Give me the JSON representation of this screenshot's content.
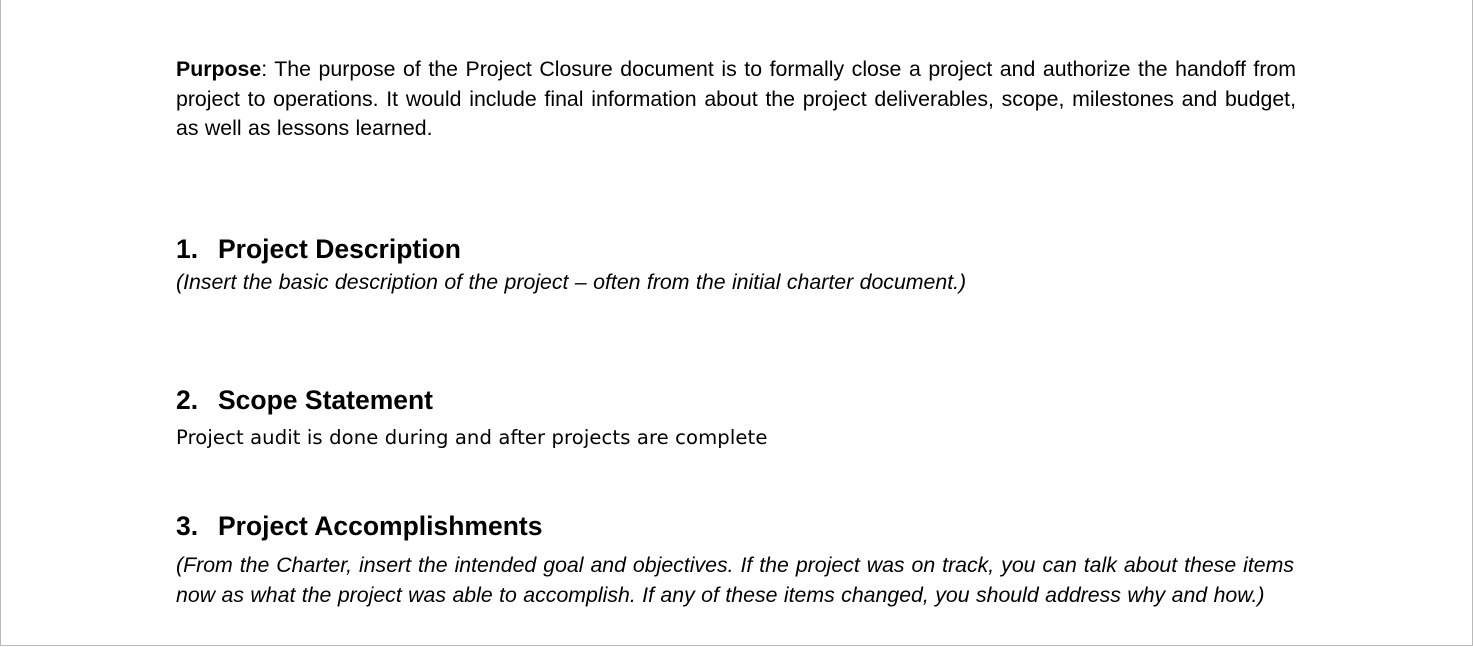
{
  "document": {
    "purpose": {
      "label": "Purpose",
      "separator": ":",
      "text": " The purpose of the Project Closure document is to formally close a project and authorize the handoff from project to operations. It would include final information about the project deliverables, scope, milestones and budget, as well as lessons learned."
    },
    "sections": [
      {
        "number": "1.",
        "title": "Project Description",
        "body": "(Insert the basic description of the project – often from the initial charter document.)",
        "body_style": "italic"
      },
      {
        "number": "2.",
        "title": "Scope Statement",
        "body": "Project audit is done during and after projects are complete",
        "body_style": "regular"
      },
      {
        "number": "3.",
        "title": "Project Accomplishments",
        "body": "(From the Charter, insert the intended goal and objectives.  If the project was on track, you can talk about these items now as what the project was able to accomplish.  If any of these items changed, you should address why and how.)",
        "body_style": "italic"
      }
    ]
  }
}
